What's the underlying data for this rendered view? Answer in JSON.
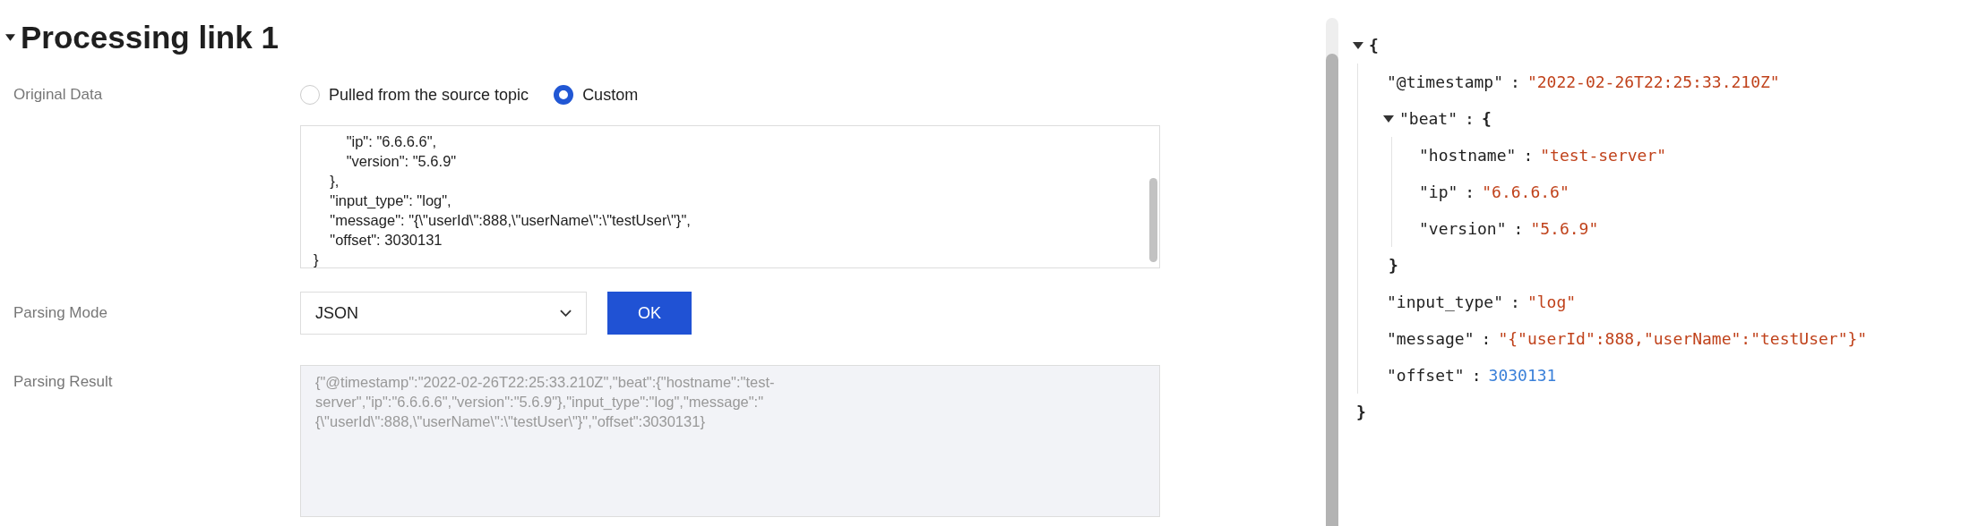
{
  "section": {
    "title": "Processing link 1",
    "expanded": true
  },
  "original_data": {
    "label": "Original Data",
    "options": [
      {
        "label": "Pulled from the source topic",
        "selected": false
      },
      {
        "label": "Custom",
        "selected": true
      }
    ],
    "lines": [
      "        \"ip\": \"6.6.6.6\",",
      "        \"version\": \"5.6.9\"",
      "    },",
      "    \"input_type\": \"log\",",
      "    \"message\": \"{\\\"userId\\\":888,\\\"userName\\\":\\\"testUser\\\"}\",",
      "    \"offset\": 3030131",
      "}"
    ]
  },
  "parsing_mode": {
    "label": "Parsing Mode",
    "value": "JSON",
    "button": "OK"
  },
  "parsing_result": {
    "label": "Parsing Result",
    "value": "{\"@timestamp\":\"2022-02-26T22:25:33.210Z\",\"beat\":{\"hostname\":\"test-server\",\"ip\":\"6.6.6.6\",\"version\":\"5.6.9\"},\"input_type\":\"log\",\"message\":\"{\\\"userId\\\":888,\\\"userName\\\":\\\"testUser\\\"}\",\"offset\":3030131}",
    "disabled": true
  },
  "json_viewer": {
    "open": "{",
    "close": "}",
    "expanded": true,
    "children": [
      {
        "kind": "string",
        "key": "\"@timestamp\"",
        "separator": ":",
        "value": "\"2022-02-26T22:25:33.210Z\""
      },
      {
        "kind": "object",
        "key": "\"beat\"",
        "separator": ":",
        "open": "{",
        "close": "}",
        "expanded": true,
        "children": [
          {
            "kind": "string",
            "key": "\"hostname\"",
            "separator": ":",
            "value": "\"test-server\""
          },
          {
            "kind": "string",
            "key": "\"ip\"",
            "separator": ":",
            "value": "\"6.6.6.6\""
          },
          {
            "kind": "string",
            "key": "\"version\"",
            "separator": ":",
            "value": "\"5.6.9\""
          }
        ]
      },
      {
        "kind": "string",
        "key": "\"input_type\"",
        "separator": ":",
        "value": "\"log\""
      },
      {
        "kind": "string",
        "key": "\"message\"",
        "separator": ":",
        "value": "\"{\"userId\":888,\"userName\":\"testUser\"}\""
      },
      {
        "kind": "number",
        "key": "\"offset\"",
        "separator": ":",
        "value": "3030131"
      }
    ]
  }
}
